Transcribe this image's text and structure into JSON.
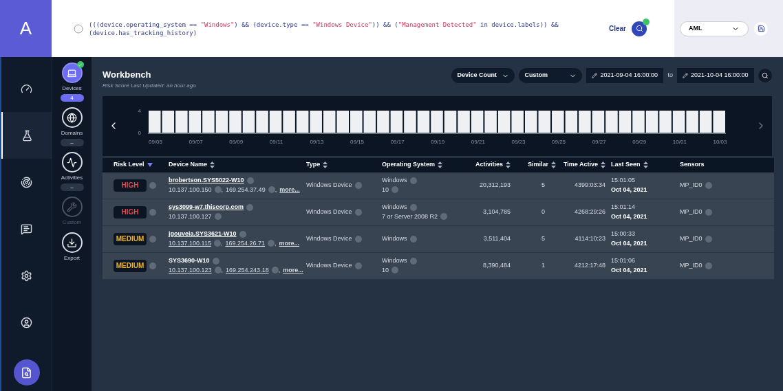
{
  "query": [
    {
      "kind": "code",
      "text": "(((device.operating_system == "
    },
    {
      "kind": "string",
      "text": "\"Windows\""
    },
    {
      "kind": "code",
      "text": ") && (device.type == "
    },
    {
      "kind": "string",
      "text": "\"Windows Device\""
    },
    {
      "kind": "code",
      "text": ")) && ("
    },
    {
      "kind": "string",
      "text": "\"Management Detected\""
    },
    {
      "kind": "code",
      "text": " in device.labels)) && (device.has_tracking_history)"
    }
  ],
  "logo": "A",
  "clear_label": "Clear",
  "mode_select": "AML",
  "rail": [
    {
      "selected": false
    },
    {
      "selected": true
    },
    {
      "selected": false
    },
    {
      "selected": false
    },
    {
      "selected": false
    },
    {
      "selected": false
    }
  ],
  "facets": [
    {
      "label": "Devices",
      "badge": "4",
      "active": true,
      "disabled": false
    },
    {
      "label": "Domains",
      "badge": "–",
      "active": false,
      "disabled": false
    },
    {
      "label": "Activities",
      "badge": "–",
      "active": false,
      "disabled": false
    },
    {
      "label": "Custom",
      "active": false,
      "disabled": true
    },
    {
      "label": "Export",
      "active": false,
      "disabled": false
    }
  ],
  "title": "Workbench",
  "subtitle": "Risk Score Last Updated: an hour ago",
  "metric_select": "Device Count",
  "range_select": "Custom",
  "date_from": "2021-09-04 16:00:00",
  "date_sep": "to",
  "date_to": "2021-10-04 16:00:00",
  "chart_data": {
    "type": "bar",
    "yticks": [
      0,
      4
    ],
    "ylim": [
      0,
      4
    ],
    "categories": [
      "09/05",
      null,
      null,
      "09/07",
      null,
      null,
      "09/09",
      null,
      null,
      "09/11",
      null,
      null,
      "09/13",
      null,
      null,
      "09/15",
      null,
      null,
      "09/17",
      null,
      null,
      "09/19",
      null,
      null,
      "09/21",
      null,
      null,
      "09/23",
      null,
      null,
      "09/25",
      null,
      null,
      "09/27",
      null,
      null,
      "09/29",
      null,
      null,
      "10/01",
      null,
      null,
      "10/03"
    ],
    "values": [
      4,
      4,
      4,
      4,
      4,
      4,
      4,
      4,
      4,
      4,
      4,
      4,
      4,
      4,
      4,
      4,
      4,
      4,
      4,
      4,
      4,
      4,
      4,
      4,
      4,
      4,
      4,
      4,
      4,
      4,
      4,
      4,
      4,
      4,
      4,
      4,
      4,
      4,
      4,
      4,
      4,
      4,
      4
    ]
  },
  "table": {
    "columns": [
      {
        "label": "Risk Level",
        "kind": "sorted"
      },
      {
        "label": "Device Name",
        "kind": "sortable"
      },
      {
        "label": "Type",
        "kind": "sortable"
      },
      {
        "label": "Operating System",
        "kind": "sortable"
      },
      {
        "label": "Activities",
        "kind": "sortable"
      },
      {
        "label": "Similar",
        "kind": "sortable"
      },
      {
        "label": "Time Active",
        "kind": "sortable"
      },
      {
        "label": "Last Seen",
        "kind": "sortable"
      },
      {
        "label": "Sensors",
        "kind": "plain"
      }
    ],
    "rows": [
      {
        "risk": "HIGH",
        "color": "#e5484d",
        "name": "brobertson.SYS5022-W10",
        "name_link": true,
        "ips": [
          {
            "text": "10.137.100.150",
            "sep": ","
          },
          {
            "text": "169.254.37.49",
            "sep": ","
          }
        ],
        "ips_link": false,
        "more": "more...",
        "type": "Windows Device",
        "os": [
          "Windows",
          "10"
        ],
        "activities": "20,312,193",
        "similar": "5",
        "time_active": "4399:03:34",
        "time": "15:01:05",
        "date": "Oct 04, 2021",
        "sensor": "MP_ID0"
      },
      {
        "risk": "HIGH",
        "color": "#e5484d",
        "name": "sys3099-w7.thiscorp.com",
        "name_link": true,
        "ips": [
          {
            "text": "10.137.100.127"
          }
        ],
        "ips_link": false,
        "type": "Windows Device",
        "os": [
          "Windows",
          "7 or Server 2008 R2"
        ],
        "activities": "3,104,785",
        "similar": "0",
        "time_active": "4268:29:26",
        "time": "15:01:14",
        "date": "Oct 04, 2021",
        "sensor": "MP_ID0"
      },
      {
        "risk": "MEDIUM",
        "color": "#f0b429",
        "name": "jgouveia.SYS3621-W10",
        "name_link": true,
        "ips": [
          {
            "text": "10.137.100.115",
            "sep": ","
          },
          {
            "text": "169.254.26.71",
            "sep": ","
          }
        ],
        "ips_link": true,
        "more": "more...",
        "type": "Windows Device",
        "os": [
          "Windows"
        ],
        "activities": "3,511,404",
        "similar": "5",
        "time_active": "4114:10:23",
        "time": "15:00:33",
        "date": "Oct 04, 2021",
        "sensor": "MP_ID0"
      },
      {
        "risk": "MEDIUM",
        "color": "#f0b429",
        "name": "SYS3690-W10",
        "name_link": false,
        "ips": [
          {
            "text": "10.137.100.123",
            "sep": ","
          },
          {
            "text": "169.254.243.18",
            "sep": ","
          }
        ],
        "ips_link": true,
        "more": "more...",
        "type": "Windows Device",
        "os": [
          "Windows",
          "10"
        ],
        "activities": "8,390,484",
        "similar": "1",
        "time_active": "4212:17:48",
        "time": "15:01:06",
        "date": "Oct 04, 2021",
        "sensor": "MP_ID0"
      }
    ]
  }
}
